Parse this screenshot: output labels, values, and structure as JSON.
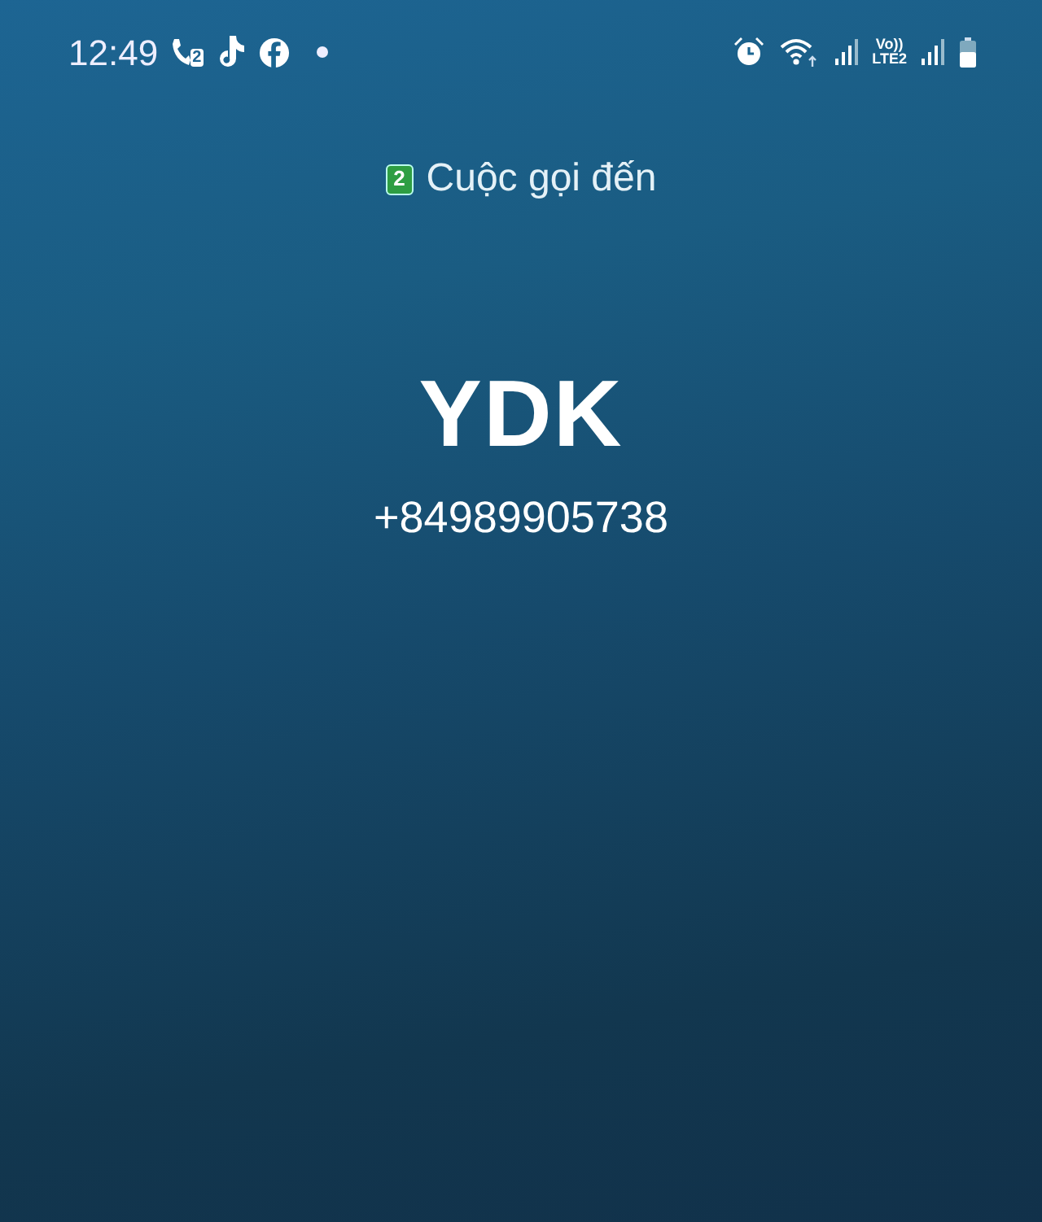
{
  "status_bar": {
    "time": "12:49",
    "call_sim": "2",
    "volte": "Vo))",
    "lte": "LTE2"
  },
  "call": {
    "sim": "2",
    "label": "Cuộc gọi đến",
    "name": "YDK",
    "number": "+84989905738"
  }
}
